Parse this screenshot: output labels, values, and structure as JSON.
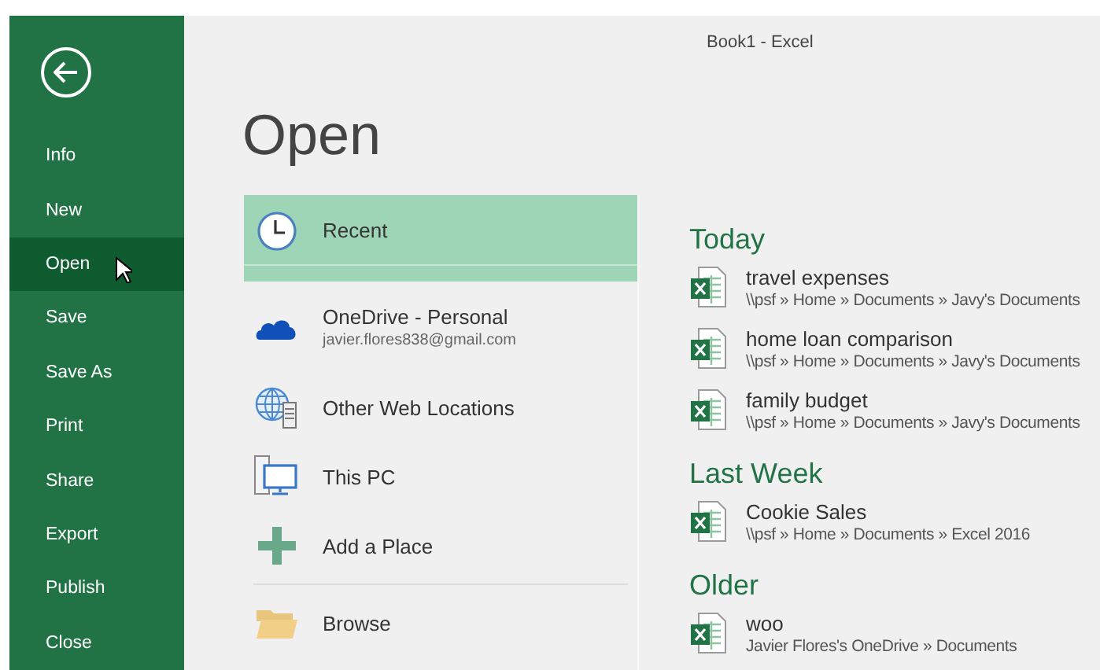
{
  "window": {
    "title": "Book1 - Excel"
  },
  "sidebar": {
    "items": [
      {
        "label": "Info",
        "selected": false
      },
      {
        "label": "New",
        "selected": false
      },
      {
        "label": "Open",
        "selected": true
      },
      {
        "label": "Save",
        "selected": false
      },
      {
        "label": "Save As",
        "selected": false
      },
      {
        "label": "Print",
        "selected": false
      },
      {
        "label": "Share",
        "selected": false
      },
      {
        "label": "Export",
        "selected": false
      },
      {
        "label": "Publish",
        "selected": false
      },
      {
        "label": "Close",
        "selected": false
      }
    ]
  },
  "page": {
    "title": "Open"
  },
  "places": [
    {
      "kind": "recent",
      "label": "Recent",
      "selected": true
    },
    {
      "kind": "onedrive",
      "label": "OneDrive - Personal",
      "detail": "javier.flores838@gmail.com",
      "selected": false
    },
    {
      "kind": "web",
      "label": "Other Web Locations",
      "selected": false
    },
    {
      "kind": "pc",
      "label": "This PC",
      "selected": false
    },
    {
      "kind": "add",
      "label": "Add a Place",
      "selected": false
    },
    {
      "kind": "browse",
      "label": "Browse",
      "selected": false,
      "separated": true
    }
  ],
  "recent": [
    {
      "heading": "Today",
      "files": [
        {
          "name": "travel expenses",
          "path": "\\\\psf » Home » Documents » Javy's Documents"
        },
        {
          "name": "home loan comparison",
          "path": "\\\\psf » Home » Documents » Javy's Documents"
        },
        {
          "name": "family budget",
          "path": "\\\\psf » Home » Documents » Javy's Documents"
        }
      ]
    },
    {
      "heading": "Last Week",
      "files": [
        {
          "name": "Cookie Sales",
          "path": "\\\\psf » Home » Documents » Excel 2016"
        }
      ]
    },
    {
      "heading": "Older",
      "files": [
        {
          "name": "woo",
          "path": "Javier Flores's OneDrive » Documents"
        }
      ]
    }
  ]
}
